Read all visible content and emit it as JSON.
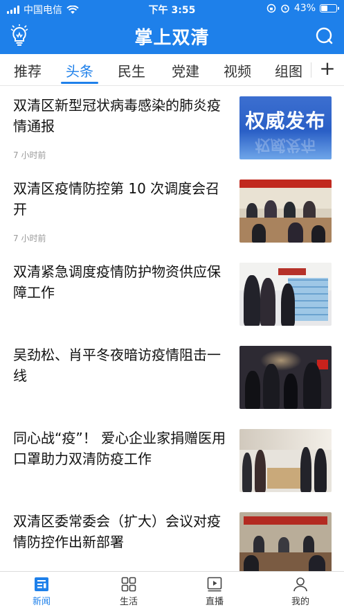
{
  "status_bar": {
    "carrier": "中国电信",
    "time": "下午 3:55",
    "battery_text": "43%",
    "battery_level": 0.43
  },
  "app_bar": {
    "title": "掌上双清",
    "left_icon": "lightbulb-icon",
    "right_icon": "search-icon"
  },
  "tabs": {
    "items": [
      {
        "label": "推荐"
      },
      {
        "label": "头条"
      },
      {
        "label": "民生"
      },
      {
        "label": "党建"
      },
      {
        "label": "视频"
      },
      {
        "label": "组图"
      }
    ],
    "active": "头条",
    "add_label": "+"
  },
  "feed": {
    "items": [
      {
        "title": "双清区新型冠状病毒感染的肺炎疫情通报",
        "time": "7 小时前",
        "thumb_text": "权威发布"
      },
      {
        "title": "双清区疫情防控第 10 次调度会召开",
        "time": "7 小时前",
        "thumb_text": ""
      },
      {
        "title": "双清紧急调度疫情防护物资供应保障工作",
        "time": "",
        "thumb_text": ""
      },
      {
        "title": "吴劲松、肖平冬夜暗访疫情阻击一线",
        "time": "",
        "thumb_text": ""
      },
      {
        "title": "同心战“疫”！ 爱心企业家捐赠医用口罩助力双清防疫工作",
        "time": "",
        "thumb_text": ""
      },
      {
        "title": "双清区委常委会（扩大）会议对疫情防控作出新部署",
        "time": "",
        "thumb_text": ""
      }
    ]
  },
  "bottom_nav": {
    "items": [
      {
        "label": "新闻",
        "icon": "news-icon"
      },
      {
        "label": "生活",
        "icon": "grid-icon"
      },
      {
        "label": "直播",
        "icon": "play-icon"
      },
      {
        "label": "我的",
        "icon": "user-icon"
      }
    ],
    "active": "新闻"
  },
  "colors": {
    "brand": "#1e80ea",
    "text": "#111111",
    "muted": "#999999"
  }
}
